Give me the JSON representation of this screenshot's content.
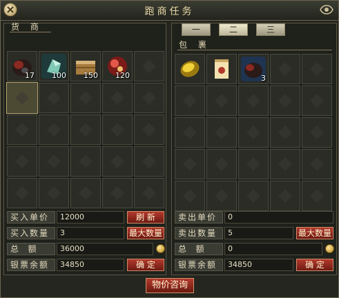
{
  "window": {
    "title": "跑商任务"
  },
  "merchant": {
    "label": "货 商",
    "items": [
      {
        "icon": "red-black-ore-icon",
        "qty": "17"
      },
      {
        "icon": "jade-crystal-icon",
        "qty": "100"
      },
      {
        "icon": "wooden-crate-icon",
        "qty": "150"
      },
      {
        "icon": "red-orb-icon",
        "qty": "120"
      }
    ],
    "buy_price_label": "买入单价",
    "buy_price_value": "12000",
    "refresh_label": "刷 新",
    "buy_qty_label": "买入数量",
    "buy_qty_value": "3",
    "max_qty_label": "最大数量",
    "total_label": "总  额",
    "total_value": "36000",
    "balance_label": "银票余额",
    "balance_value": "34850",
    "confirm_label": "确 定"
  },
  "bag": {
    "label": "包 裹",
    "tabs": [
      "一",
      "二",
      "三"
    ],
    "active_tab": 1,
    "items": [
      {
        "icon": "golden-gem-icon",
        "qty": ""
      },
      {
        "icon": "scroll-document-icon",
        "qty": ""
      },
      {
        "icon": "red-black-ore-icon",
        "qty": "3"
      }
    ],
    "sell_price_label": "卖出单价",
    "sell_price_value": "0",
    "sell_qty_label": "卖出数量",
    "sell_qty_value": "5",
    "max_qty_label": "最大数量",
    "total_label": "总  额",
    "total_value": "0",
    "balance_label": "银票余额",
    "balance_value": "34850",
    "confirm_label": "确 定"
  },
  "price_inquiry_label": "物价咨询",
  "colors": {
    "accent": "#b23a2d",
    "text": "#e8dcb8",
    "panel": "#1f211b"
  }
}
